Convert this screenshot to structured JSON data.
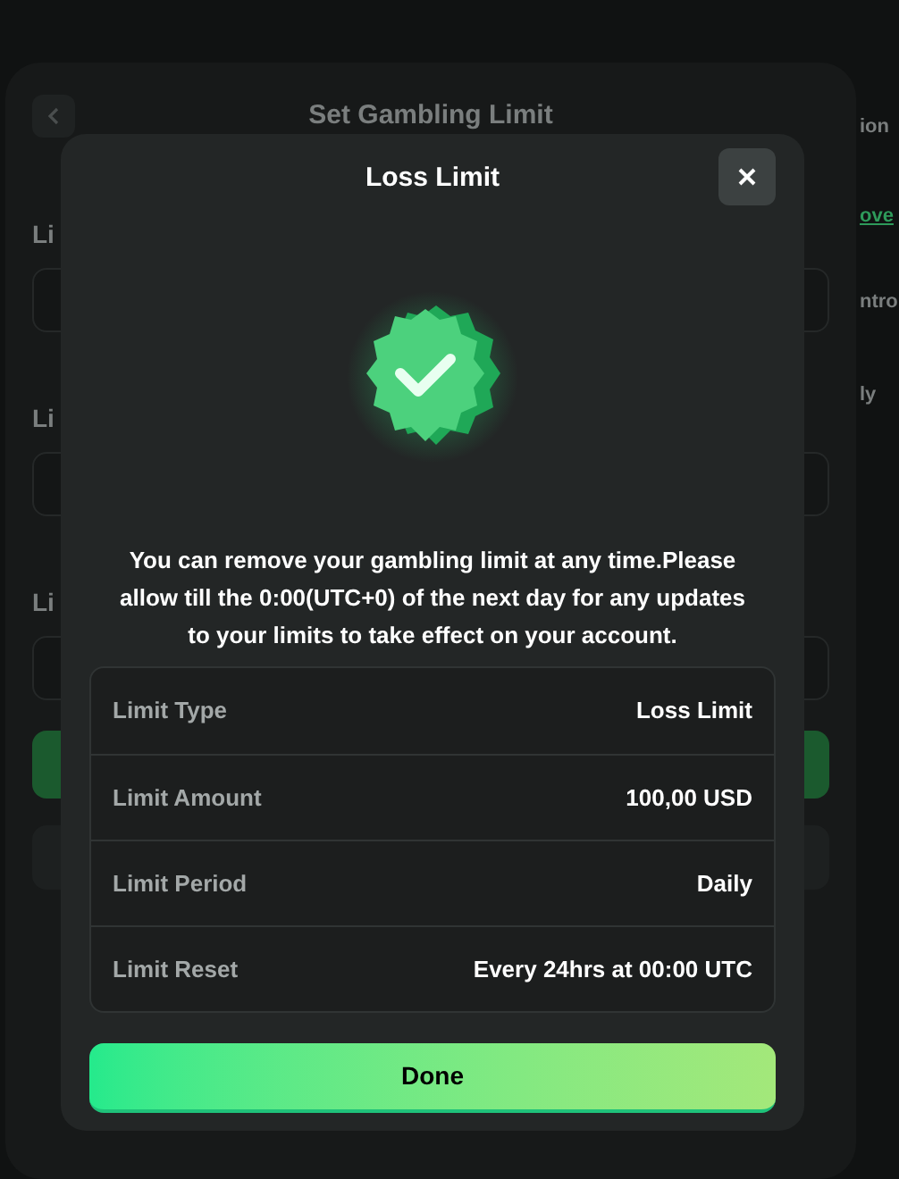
{
  "background": {
    "title": "Set Gambling Limit",
    "labels": [
      "Li",
      "Li",
      "Li"
    ],
    "side_texts": [
      {
        "text": "ion",
        "kind": "plain"
      },
      {
        "text": "ove",
        "kind": "link"
      },
      {
        "text": "ntro",
        "kind": "plain"
      },
      {
        "text": "ly",
        "kind": "plain"
      }
    ]
  },
  "dialog": {
    "title": "Loss Limit",
    "message": "You can remove your gambling limit at any time.Please allow till the 0:00(UTC+0) of the next day for any updates to your limits to take effect on your account.",
    "details": [
      {
        "label": "Limit Type",
        "value": "Loss Limit"
      },
      {
        "label": "Limit Amount",
        "value": "100,00 USD"
      },
      {
        "label": "Limit Period",
        "value": "Daily"
      },
      {
        "label": "Limit Reset",
        "value": "Every 24hrs at 00:00 UTC"
      }
    ],
    "done_button": "Done"
  }
}
